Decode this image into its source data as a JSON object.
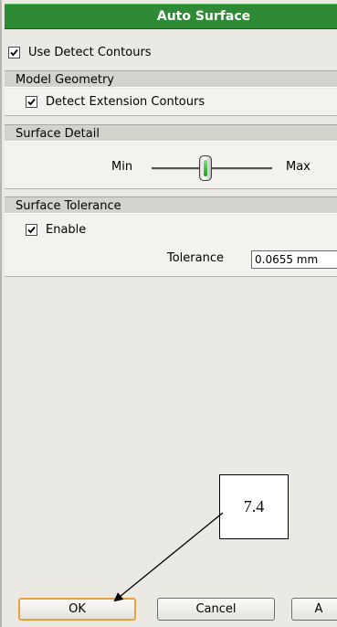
{
  "dialog": {
    "title": "Auto Surface"
  },
  "options": {
    "use_detect_contours": "Use Detect Contours"
  },
  "model_geometry": {
    "header": "Model Geometry",
    "detect_extension_contours": "Detect Extension Contours"
  },
  "surface_detail": {
    "header": "Surface Detail",
    "min_label": "Min",
    "max_label": "Max",
    "slider_level": 0.45
  },
  "surface_tolerance": {
    "header": "Surface Tolerance",
    "enable": "Enable",
    "tolerance_label": "Tolerance",
    "tolerance_value": "0.0655 mm"
  },
  "buttons": {
    "ok": "OK",
    "cancel": "Cancel",
    "apply": "A"
  },
  "annotation": {
    "callout": "7.4"
  }
}
